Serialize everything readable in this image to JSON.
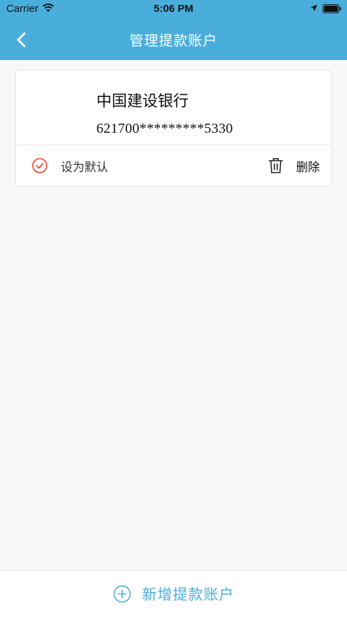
{
  "status_bar": {
    "carrier": "Carrier",
    "time": "5:06 PM",
    "icons": [
      "wifi-icon",
      "location-icon",
      "battery-icon"
    ]
  },
  "nav": {
    "title": "管理提款账户",
    "back_icon": "chevron-left-icon"
  },
  "account_card": {
    "bank_name": "中国建设银行",
    "card_number": "621700*********5330",
    "default_label": "设为默认",
    "delete_label": "删除",
    "default_icon": "check-circle-icon",
    "delete_icon": "trash-icon"
  },
  "footer": {
    "add_label": "新增提款账户",
    "add_icon": "plus-circle-icon"
  },
  "colors": {
    "accent": "#4aaedc",
    "check": "#e8533f",
    "background": "#f7f7f7"
  }
}
